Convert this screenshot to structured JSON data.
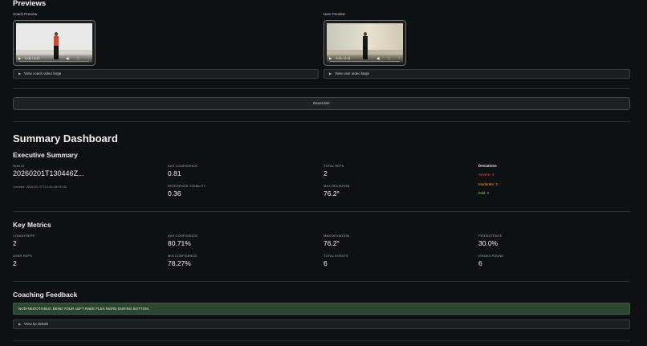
{
  "previews": {
    "title": "Previews",
    "coach": {
      "label": "Coach Preview",
      "time": "0:00 / 0:11",
      "detail": "View coach video large"
    },
    "user": {
      "label": "User Preview",
      "time": "0:00 / 0:11",
      "detail": "View user video large"
    }
  },
  "reset_button": "Reset Mirr",
  "dashboard": {
    "title": "Summary Dashboard"
  },
  "executive": {
    "title": "Executive Summary",
    "run_id_label": "RUN ID",
    "run_id_value": "20260201T130446Z...",
    "created": "Created: 2026-02-07T13:04:46+00:00",
    "avg_conf_label": "AVG CONFIDENCE",
    "avg_conf_value": "0.81",
    "ref_stab_label": "REFERENCE STABILITY",
    "ref_stab_value": "0.36",
    "total_reps_label": "TOTAL REPS",
    "total_reps_value": "2",
    "max_dev_label": "MAX DEVIATION",
    "max_dev_value": "76.2°",
    "deviations": {
      "title": "Deviations",
      "severe": "Severe: 4",
      "moderate": "Moderate: 2",
      "mild": "Mild: 0",
      "colors": {
        "severe": "#e0513e",
        "moderate": "#f0a040",
        "mild": "#6fcf7a"
      }
    }
  },
  "key_metrics": {
    "title": "Key Metrics",
    "coach_reps_label": "COACH REPS",
    "coach_reps_value": "2",
    "user_reps_label": "USER REPS",
    "user_reps_value": "2",
    "avg_conf_label": "AVG CONFIDENCE",
    "avg_conf_value": "80.71%",
    "min_conf_label": "MIN CONFIDENCE",
    "min_conf_value": "78.27%",
    "max_dev_label": "MAX DEVIATION",
    "max_dev_value": "76.2°",
    "total_events_label": "TOTAL EVENTS",
    "total_events_value": "6",
    "persistence_label": "PERSISTENCE",
    "persistence_value": "30.0%",
    "issues_label": "ISSUES FOUND",
    "issues_value": "6"
  },
  "coaching": {
    "title": "Coaching Feedback",
    "message": "NON-NEGOTIABLE: BEND YOUR LEFT KNEE FLEX MORE DURING BOTTOM.",
    "tip_detail": "View tip details"
  }
}
